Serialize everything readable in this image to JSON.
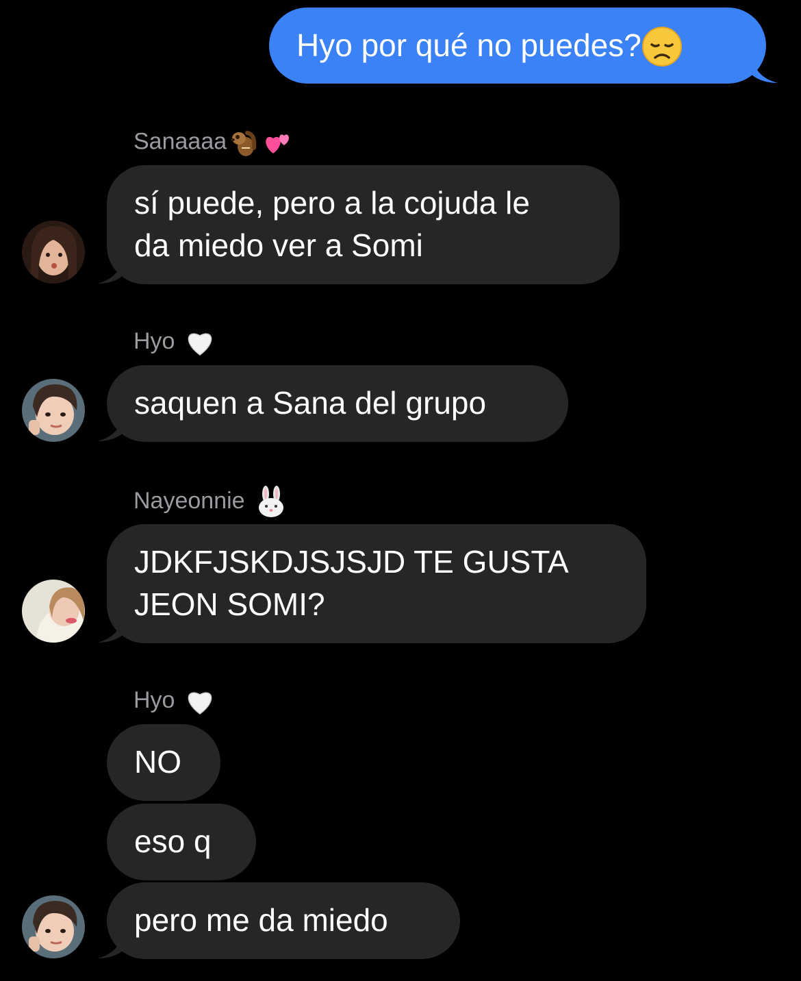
{
  "conversation": {
    "outgoing": {
      "text": "Hyo por qué no puedes?",
      "emoji_icon": "disappointed-face-icon"
    },
    "groups": [
      {
        "sender_name": "Sanaaaa",
        "sender_emojis": [
          "chipmunk-icon",
          "two-hearts-icon"
        ],
        "messages": [
          {
            "lines": [
              "sí puede, pero a la cojuda le",
              "da miedo ver a Somi"
            ]
          }
        ]
      },
      {
        "sender_name": "Hyo",
        "sender_emojis": [
          "white-heart-icon"
        ],
        "messages": [
          {
            "lines": [
              "saquen a Sana del grupo"
            ]
          }
        ]
      },
      {
        "sender_name": "Nayeonnie",
        "sender_emojis": [
          "rabbit-face-icon"
        ],
        "messages": [
          {
            "lines": [
              "JDKFJSKDJSJSJD TE GUSTA",
              "JEON SOMI?"
            ]
          }
        ]
      },
      {
        "sender_name": "Hyo",
        "sender_emojis": [
          "white-heart-icon"
        ],
        "messages": [
          {
            "lines": [
              "NO"
            ]
          },
          {
            "lines": [
              "eso q"
            ]
          },
          {
            "lines": [
              "pero me da miedo"
            ]
          }
        ]
      }
    ]
  },
  "colors": {
    "background": "#000000",
    "incoming_bubble": "#262629",
    "outgoing_bubble": "#3b82f6",
    "sender_text": "#9b9ba1"
  }
}
